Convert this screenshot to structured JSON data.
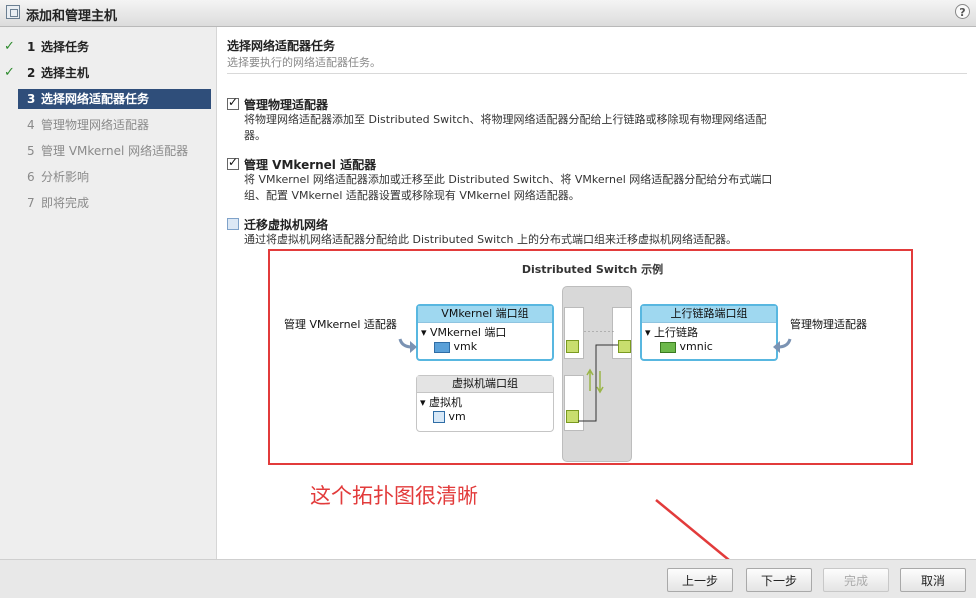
{
  "window": {
    "title": "添加和管理主机",
    "help": "?"
  },
  "steps": [
    {
      "num": "1",
      "label": "选择任务",
      "state": "done"
    },
    {
      "num": "2",
      "label": "选择主机",
      "state": "done"
    },
    {
      "num": "3",
      "label": "选择网络适配器任务",
      "state": "active"
    },
    {
      "num": "4",
      "label": "管理物理网络适配器",
      "state": "todo"
    },
    {
      "num": "5",
      "label": "管理 VMkernel 网络适配器",
      "state": "todo"
    },
    {
      "num": "6",
      "label": "分析影响",
      "state": "todo"
    },
    {
      "num": "7",
      "label": "即将完成",
      "state": "todo"
    }
  ],
  "main": {
    "title": "选择网络适配器任务",
    "subtitle": "选择要执行的网络适配器任务。",
    "options": [
      {
        "label": "管理物理适配器",
        "checked": true,
        "desc": "将物理网络适配器添加至 Distributed Switch、将物理网络适配器分配给上行链路或移除现有物理网络适配器。"
      },
      {
        "label": "管理 VMkernel 适配器",
        "checked": true,
        "desc": "将 VMkernel 网络适配器添加或迁移至此 Distributed Switch、将 VMkernel 网络适配器分配给分布式端口组、配置 VMkernel 适配器设置或移除现有 VMkernel 网络适配器。"
      },
      {
        "label": "迁移虚拟机网络",
        "checked": false,
        "desc": "通过将虚拟机网络适配器分配给此 Distributed Switch 上的分布式端口组来迁移虚拟机网络适配器。"
      }
    ]
  },
  "diagram": {
    "title": "Distributed Switch 示例",
    "left_label": "管理 VMkernel 适配器",
    "right_label": "管理物理适配器",
    "vmk_group": {
      "header": "VMkernel 端口组",
      "item": "VMkernel 端口",
      "child": "vmk"
    },
    "vm_group": {
      "header": "虚拟机端口组",
      "item": "虚拟机",
      "child": "vm"
    },
    "uplink_group": {
      "header": "上行链路端口组",
      "item": "上行链路",
      "child": "vmnic"
    }
  },
  "annotation": "这个拓扑图很清晰",
  "buttons": {
    "back": "上一步",
    "next": "下一步",
    "finish": "完成",
    "cancel": "取消"
  },
  "colors": {
    "active_step": "#2f4e7a",
    "check": "#2e8b2e",
    "highlight": "#e23b3b",
    "group_header": "#9fd8f0"
  }
}
